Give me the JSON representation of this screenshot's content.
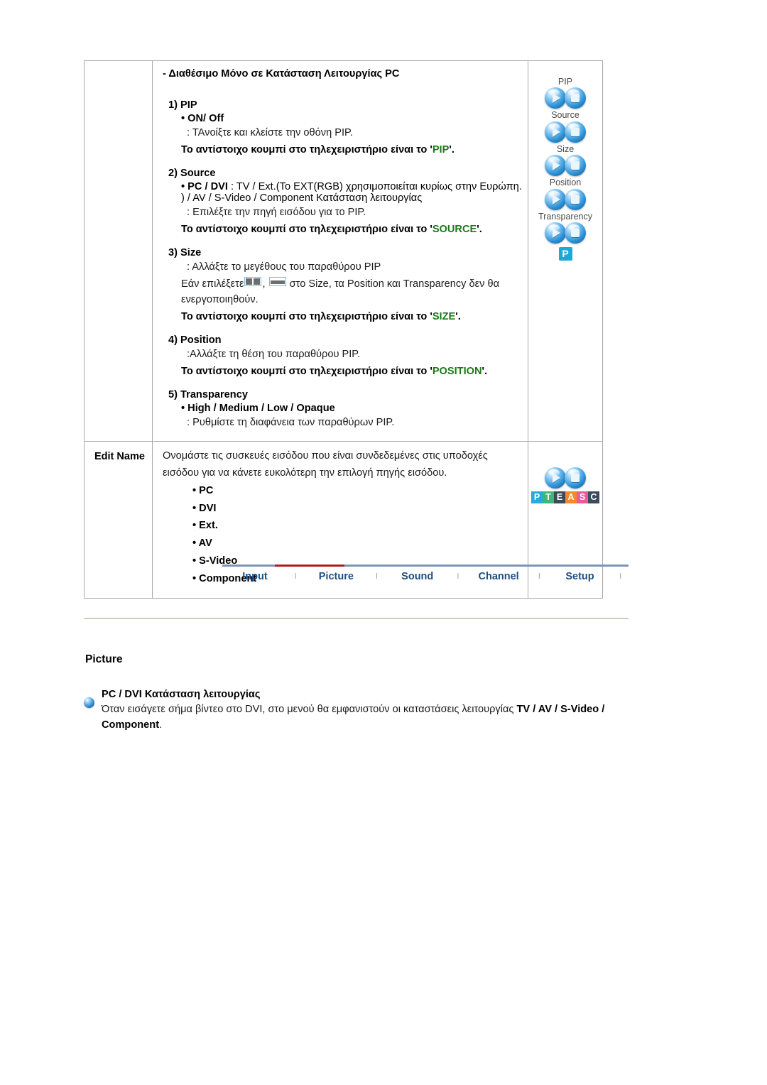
{
  "table": {
    "rows": [
      {
        "label": "",
        "intro": "- Διαθέσιμο Μόνο σε Κατάσταση Λειτουργίας PC",
        "sections": [
          {
            "title": "1) PIP",
            "bullet": "• ON/ Off",
            "detail": ": ΤΑνοίξτε και κλείστε την οθόνη PIP.",
            "remote_prefix": "Το αντίστοιχο κουμπί στο τηλεχειριστήριο είναι το '",
            "remote_key": "PIP",
            "remote_suffix": "'."
          },
          {
            "title": "2) Source",
            "bullet_b": "• PC / DVI",
            "bullet_rest": " : TV / Ext.(Το EXT(RGB) χρησιμοποιείται κυρίως στην Ευρώπη. ) / AV / S-Video / Component Κατάσταση λειτουργίας",
            "detail": ": Επιλέξτε την πηγή εισόδου για το PIP.",
            "remote_prefix": "Το αντίστοιχο κουμπί στο τηλεχειριστήριο είναι το '",
            "remote_key": "SOURCE",
            "remote_suffix": "'."
          },
          {
            "title": "3) Size",
            "detail": ": Αλλάξτε το μεγέθους του παραθύρου PIP",
            "detail2_pre": "Εάν επιλέξετε",
            "detail2_mid": ", ",
            "detail2_post": " στο Size, τα Position και Transparency δεν θα ενεργοποιηθούν.",
            "remote_prefix": "Το αντίστοιχο κουμπί στο τηλεχειριστήριο είναι το '",
            "remote_key": "SIZE",
            "remote_suffix": "'."
          },
          {
            "title": "4) Position",
            "detail": ":Αλλάξτε τη θέση του παραθύρου PIP.",
            "remote_prefix": "Το αντίστοιχο κουμπί στο τηλεχειριστήριο είναι το '",
            "remote_key": "POSITION",
            "remote_suffix": "'."
          },
          {
            "title": "5) Transparency",
            "bullet": "• High / Medium / Low / Opaque",
            "detail": ": Ρυθμίστε τη διαφάνεια των παραθύρων PIP."
          }
        ],
        "icons": {
          "groups": [
            {
              "caption": "PIP"
            },
            {
              "caption": "Source"
            },
            {
              "caption": "Size"
            },
            {
              "caption": "Position"
            },
            {
              "caption": "Transparency"
            }
          ],
          "badge": "P"
        }
      },
      {
        "label": "Edit Name",
        "paragraph_1": "Ονομάστε τις συσκευές εισόδου που είναι συνδεδεμένες στις υποδοχές",
        "paragraph_2": "εισόδου για να κάνετε ευκολότερη την επιλογή πηγής εισόδου.",
        "items": [
          "• PC",
          "• DVI",
          "• Ext.",
          "• AV",
          "• S-Video",
          "• Component"
        ],
        "strip": {
          "letters": [
            "P",
            "T",
            "E",
            "A",
            "S",
            "C"
          ],
          "colors": [
            "#2aa9e0",
            "#3cb878",
            "#3d4a5c",
            "#f08a2a",
            "#ec5a9c",
            "#3d4a5c"
          ]
        }
      }
    ]
  },
  "tabs": {
    "items": [
      "Input",
      "Picture",
      "Sound",
      "Channel",
      "Setup"
    ],
    "active": "Picture",
    "separator": "l",
    "rule_color": "#7f93b5",
    "active_color": "#b01c1c"
  },
  "bottom": {
    "section_title": "Picture",
    "note_title": "PC / DVI Κατάσταση λειτουργίας",
    "note_body_pre": "Όταν εισάγετε σήμα βίντεο στο DVI, στο μενού θα εμφανιστούν οι καταστάσεις λειτουργίας ",
    "note_body_bold": "TV / AV / S-Video / Component",
    "note_body_post": "."
  },
  "colors": {
    "green_key": "#1a7a1a",
    "tab_text": "#1b4f86",
    "table_border": "#a9a9a9",
    "badge_blue": "#1ea7d8"
  }
}
